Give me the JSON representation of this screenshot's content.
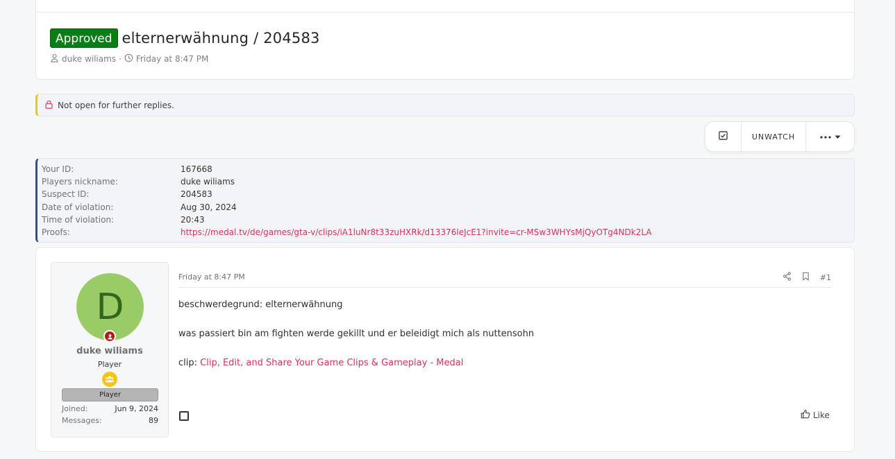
{
  "thread": {
    "prefix": "Approved",
    "title": "elternerwähnung / 204583",
    "author": "duke wiliams",
    "separator": "·",
    "date": "Friday at 8:47 PM"
  },
  "notice": {
    "text": "Not open for further replies."
  },
  "actions": {
    "unwatch_label": "UNWATCH",
    "more_icon": "ellipsis-icon"
  },
  "info": {
    "rows": [
      {
        "label": "Your ID:",
        "value": "167668"
      },
      {
        "label": "Players nickname:",
        "value": "duke wiliams"
      },
      {
        "label": "Suspect ID:",
        "value": "204583"
      },
      {
        "label": "Date of violation:",
        "value": "Aug 30, 2024"
      },
      {
        "label": "Time of violation:",
        "value": "20:43"
      },
      {
        "label": "Proofs:",
        "value": "https://medal.tv/de/games/gta-v/clips/iA1luNr8t33zuHXRk/d13376leJcE1?invite=cr-MSw3WHYsMjQyOTg4NDk2LA"
      }
    ]
  },
  "user": {
    "avatar_letter": "D",
    "name": "duke wiliams",
    "title": "Player",
    "banner": "Player",
    "joined_label": "Joined:",
    "joined_value": "Jun 9, 2024",
    "messages_label": "Messages:",
    "messages_value": "89"
  },
  "post": {
    "date": "Friday at 8:47 PM",
    "number": "#1",
    "line1": "beschwerdegrund: elternerwähnung",
    "line2": "was passiert bin am fighten werde gekillt und er beleidigt mich als nuttensohn",
    "clip_prefix": "clip: ",
    "clip_link": "Clip, Edit, and Share Your Game Clips & Gameplay - Medal",
    "like_label": "Like"
  },
  "colors": {
    "approved_badge": "#0a7d16",
    "link": "#d6325a",
    "notice_accent": "#f0c419",
    "info_accent": "#3b4a8c",
    "avatar_bg": "#99cc66",
    "avatar_text": "#33661a"
  }
}
